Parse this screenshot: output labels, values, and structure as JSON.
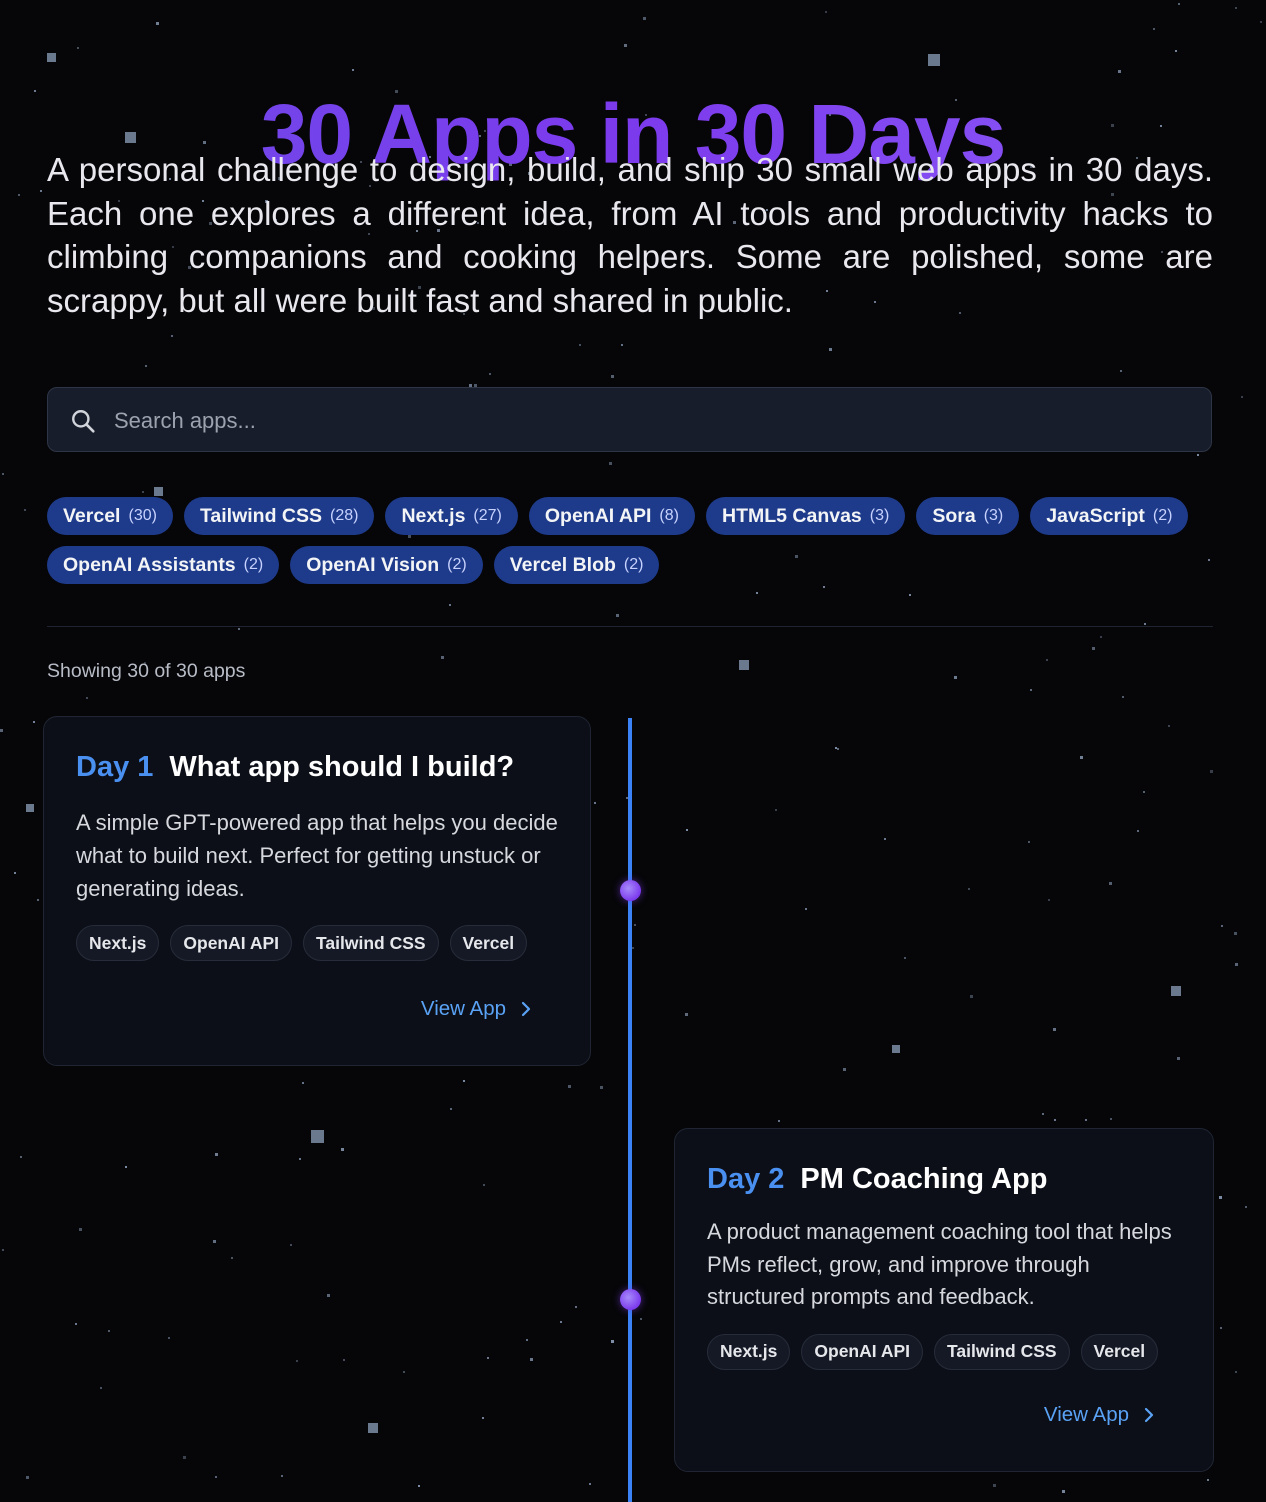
{
  "title": "30 Apps in 30 Days",
  "intro": "A personal challenge to design, build, and ship 30 small web apps in 30 days. Each one explores a different idea, from AI tools and productivity hacks to climbing companions and cooking helpers. Some are polished, some are scrappy, but all were built fast and shared in public.",
  "search": {
    "placeholder": "Search apps...",
    "icon": "search-icon"
  },
  "filters": [
    {
      "label": "Vercel",
      "count": "(30)"
    },
    {
      "label": "Tailwind CSS",
      "count": "(28)"
    },
    {
      "label": "Next.js",
      "count": "(27)"
    },
    {
      "label": "OpenAI API",
      "count": "(8)"
    },
    {
      "label": "HTML5 Canvas",
      "count": "(3)"
    },
    {
      "label": "Sora",
      "count": "(3)"
    },
    {
      "label": "JavaScript",
      "count": "(2)"
    },
    {
      "label": "OpenAI Assistants",
      "count": "(2)"
    },
    {
      "label": "OpenAI Vision",
      "count": "(2)"
    },
    {
      "label": "Vercel Blob",
      "count": "(2)"
    }
  ],
  "showing": "Showing 30 of 30 apps",
  "apps": [
    {
      "day": "Day 1",
      "title": "What app should I build?",
      "description": "A simple GPT-powered app that helps you decide what to build next. Perfect for getting unstuck or generating ideas.",
      "tags": [
        "Next.js",
        "OpenAI API",
        "Tailwind CSS",
        "Vercel"
      ],
      "link": "View App"
    },
    {
      "day": "Day 2",
      "title": "PM Coaching App",
      "description": "A product management coaching tool that helps PMs reflect, grow, and improve through structured prompts and feedback.",
      "tags": [
        "Next.js",
        "OpenAI API",
        "Tailwind CSS",
        "Vercel"
      ],
      "link": "View App"
    }
  ],
  "colors": {
    "background": "#060608",
    "title": "#7c3aed",
    "chip": "#1e3a8a",
    "accent": "#3b82f6",
    "day_label": "#4a90f0",
    "link": "#5aa2f5"
  }
}
